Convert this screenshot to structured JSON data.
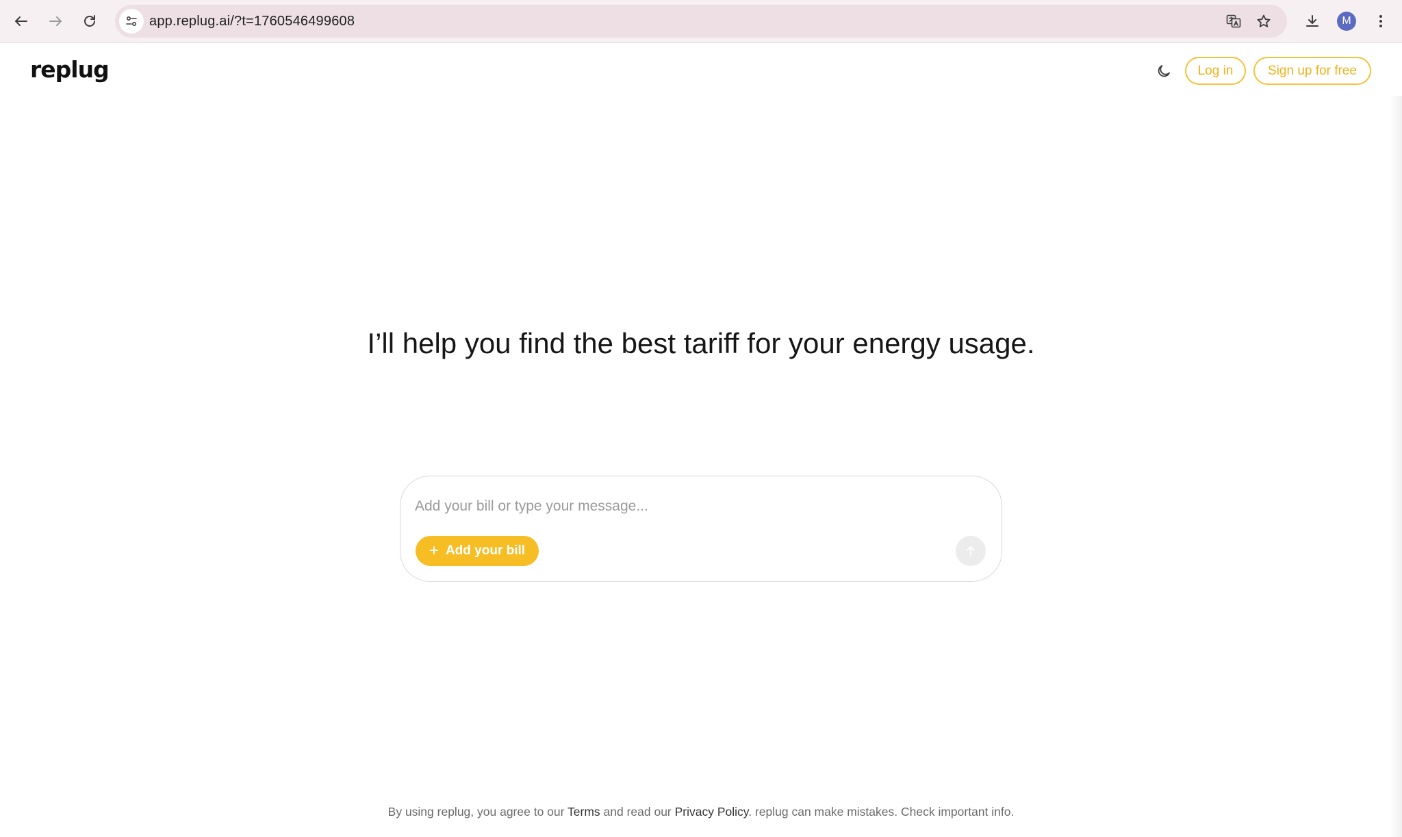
{
  "browser": {
    "url": "app.replug.ai/?t=1760546499608",
    "profile_initial": "M",
    "icons": {
      "back": "arrow-left-icon",
      "forward": "arrow-right-icon",
      "reload": "reload-icon",
      "site_info": "tune-icon",
      "translate": "translate-icon",
      "bookmark": "star-icon",
      "download": "download-icon",
      "menu": "more-vertical-icon"
    }
  },
  "header": {
    "logo": "replug",
    "login_label": "Log in",
    "signup_label": "Sign up for free",
    "theme_icon": "moon-icon"
  },
  "hero": {
    "title": "I’ll help you find the best tariff for your energy usage."
  },
  "composer": {
    "placeholder": "Add your bill or type your message...",
    "value": "",
    "add_bill_label": "Add your bill",
    "add_bill_icon": "plus-icon",
    "send_icon": "arrow-up-icon"
  },
  "footer": {
    "prefix": "By using replug, you agree to our ",
    "terms": "Terms",
    "middle": " and read our ",
    "privacy": "Privacy Policy",
    "suffix": ". replug can make mistakes. Check important info."
  },
  "colors": {
    "accent": "#f7bd25",
    "accent_text": "#f0b219",
    "chrome_bg": "#f6f0f2",
    "omnibox_bg": "#eddfe3"
  }
}
